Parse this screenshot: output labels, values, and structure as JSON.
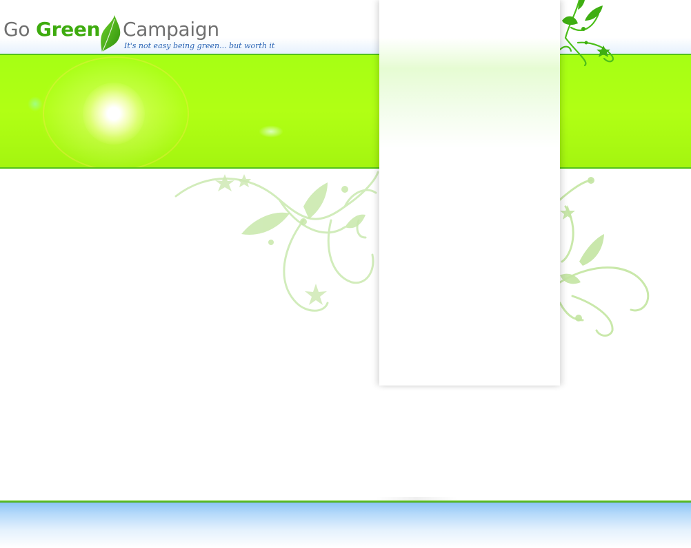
{
  "header": {
    "logo": {
      "word_go": "Go",
      "word_green": "Green",
      "word_campaign": "Campaign",
      "tagline": "It's not easy being green... but worth it"
    }
  },
  "colors": {
    "brand_green": "#3eab0f",
    "logo_gray": "#6f6f6f",
    "banner_green": "#aeff14",
    "banner_border": "#53c21a",
    "tagline_blue": "#2a64b4",
    "footer_blue": "#8cc4f5"
  },
  "icons": {
    "logo_mark": "leaf-icon",
    "decor": "vine-ornament"
  }
}
